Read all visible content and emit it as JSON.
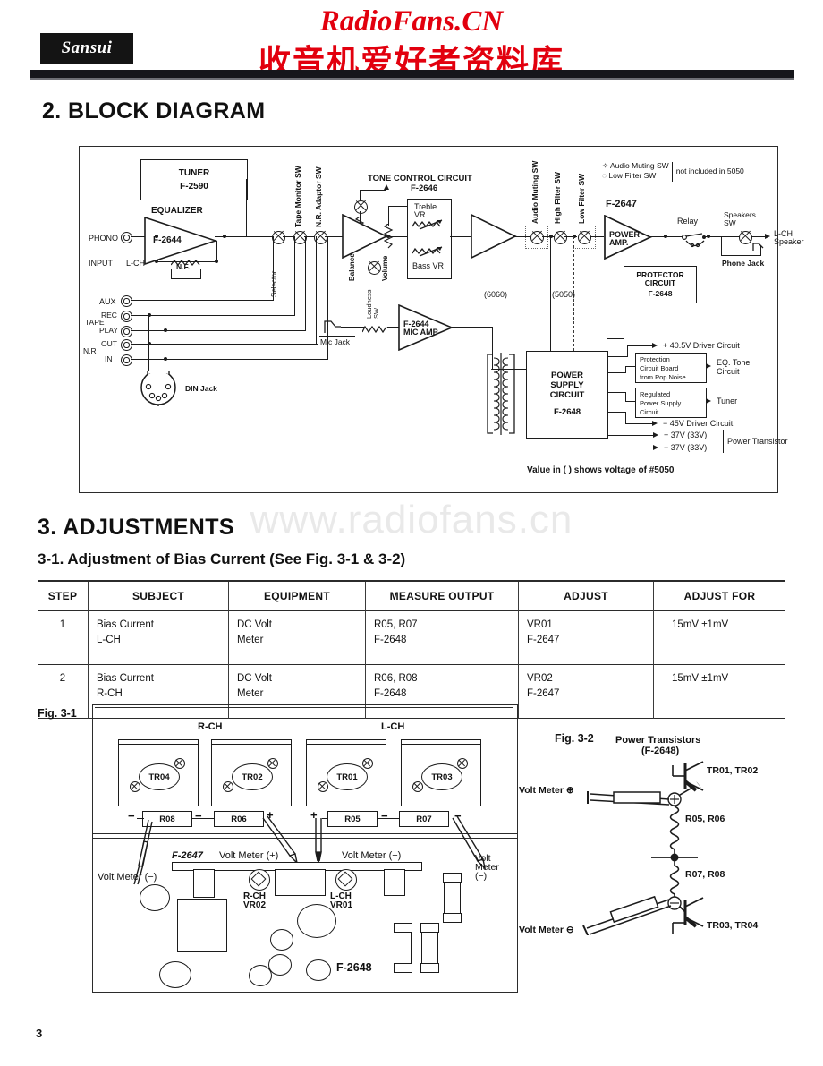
{
  "header": {
    "brand": "Sansui",
    "watermark_latin": "RadioFans.CN",
    "watermark_cn": "收音机爱好者资料库",
    "watermark_mid": "www.radiofans.cn",
    "accent_red": "#e2000e"
  },
  "page_number": "3",
  "sections": {
    "block_diagram_title": "2. BLOCK DIAGRAM",
    "adjustments_title": "3. ADJUSTMENTS",
    "adjustments_sub": "3-1. Adjustment of Bias Current (See Fig. 3-1 & 3-2)"
  },
  "block_diagram": {
    "blocks": {
      "tuner": {
        "name": "TUNER",
        "code": "F-2590"
      },
      "equalizer": {
        "name": "EQUALIZER",
        "code": "F-2644"
      },
      "nf": "N.F.",
      "tone_control": {
        "name": "TONE CONTROL CIRCUIT",
        "code": "F-2646"
      },
      "treble_vr": "Treble\nVR",
      "treble_vr_l1": "Treble",
      "treble_vr_l2": "VR",
      "bass_vr": "Bass VR",
      "power_amp": {
        "code": "F-2647",
        "l1": "POWER",
        "l2": "AMP."
      },
      "mic_amp": {
        "code": "F-2644",
        "l2": "MIC AMP"
      },
      "protector": {
        "l1": "PROTECTOR",
        "l2": "CIRCUIT",
        "code": "F-2648"
      },
      "power_supply": {
        "l1": "POWER",
        "l2": "SUPPLY",
        "l3": "CIRCUIT",
        "code": "F-2648"
      },
      "pop_noise": {
        "l1": "Protection",
        "l2": "Circuit Board",
        "l3": "from Pop Noise"
      },
      "regulated": {
        "l1": "Regulated",
        "l2": "Power Supply",
        "l3": "Circuit"
      }
    },
    "inputs": {
      "phono": "PHONO",
      "input": "INPUT",
      "lch": "L-CH",
      "aux": "AUX",
      "tape": "TAPE",
      "rec": "REC",
      "play": "PLAY",
      "nr": "N.R",
      "out": "OUT",
      "in": "IN",
      "din_jack": "DIN Jack",
      "mic_jack": "Mic Jack"
    },
    "controls": {
      "selector": "Selector",
      "tape_monitor_sw": "Tape Monitor SW",
      "nr_adaptor_sw": "N.R. Adaptor SW",
      "balance_vr": "Balance VR",
      "loudness_sw": "Loudness\nSW",
      "loudness_sw_l1": "Loudness",
      "loudness_sw_l2": "SW",
      "volume": "Volume",
      "audio_muting_sw": "Audio Muting SW",
      "high_filter_sw": "High Filter SW",
      "low_filter_sw": "Low Filter SW",
      "relay": "Relay",
      "speakers_sw_l1": "Speakers",
      "speakers_sw_l2": "SW",
      "phone_jack": "Phone Jack",
      "lch_speaker_l1": "L-CH",
      "lch_speaker_l2": "Speaker"
    },
    "notes": {
      "legend_line1": "Audio Muting SW",
      "legend_line2": "Low Filter SW",
      "legend_note": "not included in  5050",
      "model_6060": "(6060)",
      "model_5050": "(5050)",
      "footnote": "Value in (        ) shows voltage of #5050"
    },
    "supply_outputs": [
      "+ 40.5V Driver Circuit",
      "EQ. Tone\nCircuit",
      "Tuner",
      "− 45V Driver Circuit",
      "+ 37V (33V)",
      "− 37V (33V)",
      "Power Transistor"
    ],
    "supply_out_labels": {
      "o1": "+ 40.5V Driver Circuit",
      "o2_l1": "EQ. Tone",
      "o2_l2": "Circuit",
      "o3": "Tuner",
      "o4": "− 45V Driver Circuit",
      "o5": "+ 37V (33V)",
      "o6": "− 37V (33V)",
      "o7": "Power Transistor"
    }
  },
  "adjustment_table": {
    "headers": [
      "STEP",
      "SUBJECT",
      "EQUIPMENT",
      "MEASURE OUTPUT",
      "ADJUST",
      "ADJUST FOR"
    ],
    "rows": [
      {
        "step": "1",
        "subject_l1": "Bias Current",
        "subject_l2": "L-CH",
        "equipment_l1": "DC Volt",
        "equipment_l2": "Meter",
        "measure_l1": "R05, R07",
        "measure_l2": "F-2648",
        "adjust_l1": "VR01",
        "adjust_l2": "F-2647",
        "adjust_for": "15mV ±1mV"
      },
      {
        "step": "2",
        "subject_l1": "Bias Current",
        "subject_l2": "R-CH",
        "equipment_l1": "DC Volt",
        "equipment_l2": "Meter",
        "measure_l1": "R06, R08",
        "measure_l2": "F-2648",
        "adjust_l1": "VR02",
        "adjust_l2": "F-2647",
        "adjust_for": "15mV ±1mV"
      }
    ]
  },
  "fig31": {
    "label": "Fig. 3-1",
    "rch": "R-CH",
    "lch": "L-CH",
    "transistors": [
      "TR04",
      "TR02",
      "TR01",
      "TR03"
    ],
    "resistors": [
      "R08",
      "R06",
      "R05",
      "R07"
    ],
    "signs": {
      "minus": "−",
      "plus": "+"
    },
    "board_f2647": "F-2647",
    "board_f2648": "F-2648",
    "volt_meter_plus": "Volt Meter (+)",
    "volt_meter_minus": "Volt Meter (−)",
    "volt_meter_minus_l1": "Volt",
    "volt_meter_minus_l2": "Meter",
    "volt_meter_minus_l3": "(−)",
    "vr_rch_l1": "R-CH",
    "vr_rch_l2": "VR02",
    "vr_lch_l1": "L-CH",
    "vr_lch_l2": "VR01"
  },
  "fig32": {
    "label": "Fig. 3-2",
    "title_l1": "Power Transistors",
    "title_l2": "(F-2648)",
    "tr_top": "TR01, TR02",
    "tr_bottom": "TR03, TR04",
    "r_top": "R05, R06",
    "r_bottom": "R07, R08",
    "volt_meter_plus": "Volt Meter ⊕",
    "volt_meter_minus": "Volt Meter ⊖",
    "node_plus": "⊕",
    "node_minus": "⊖"
  }
}
